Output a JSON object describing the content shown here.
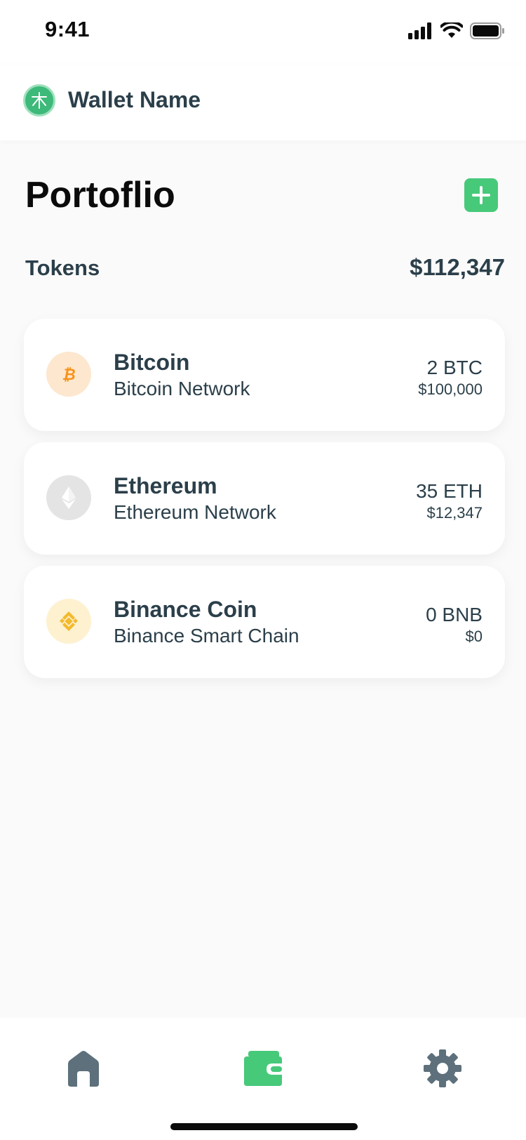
{
  "status_bar": {
    "time": "9:41"
  },
  "header": {
    "wallet_name": "Wallet Name"
  },
  "page": {
    "title": "Portoflio"
  },
  "tokens": {
    "label": "Tokens",
    "total": "$112,347",
    "items": [
      {
        "name": "Bitcoin",
        "network": "Bitcoin Network",
        "amount": "2 BTC",
        "value": "$100,000",
        "icon": "bitcoin-icon",
        "color": "#f7931a"
      },
      {
        "name": "Ethereum",
        "network": "Ethereum Network",
        "amount": "35 ETH",
        "value": "$12,347",
        "icon": "ethereum-icon",
        "color": "#b0b0b0"
      },
      {
        "name": "Binance Coin",
        "network": "Binance Smart Chain",
        "amount": "0 BNB",
        "value": "$0",
        "icon": "binance-icon",
        "color": "#f3ba2f"
      }
    ]
  },
  "bottom_nav": {
    "items": [
      {
        "icon": "home-icon",
        "active": false
      },
      {
        "icon": "wallet-icon",
        "active": true
      },
      {
        "icon": "settings-gear-icon",
        "active": false
      }
    ]
  },
  "colors": {
    "accent": "#47c97a",
    "text": "#2b3f4a",
    "nav_inactive": "#5d707b"
  }
}
